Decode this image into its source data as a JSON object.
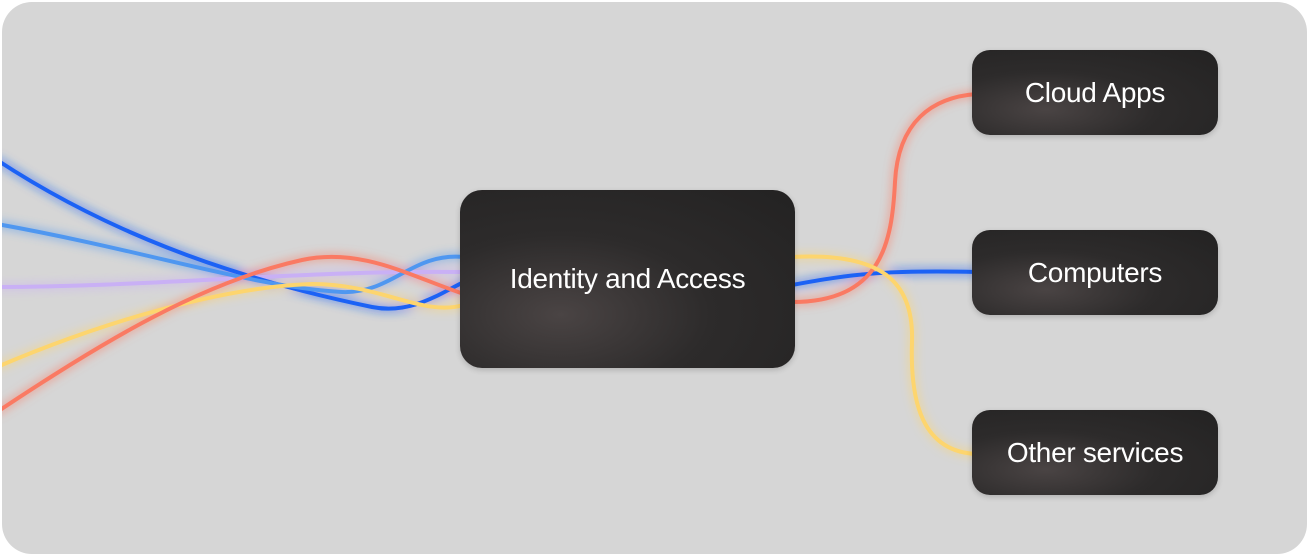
{
  "diagram": {
    "center_node": {
      "label": "Identity and Access"
    },
    "targets": [
      {
        "label": "Cloud Apps",
        "color": "#fa7a63"
      },
      {
        "label": "Computers",
        "color": "#1f62f5"
      },
      {
        "label": "Other services",
        "color": "#fdd56e"
      }
    ],
    "incoming_line_colors": [
      "#1f62f5",
      "#4f97f0",
      "#c9b0f5",
      "#fdd56e",
      "#fa7a63"
    ],
    "background_color": "#d6d6d6"
  }
}
